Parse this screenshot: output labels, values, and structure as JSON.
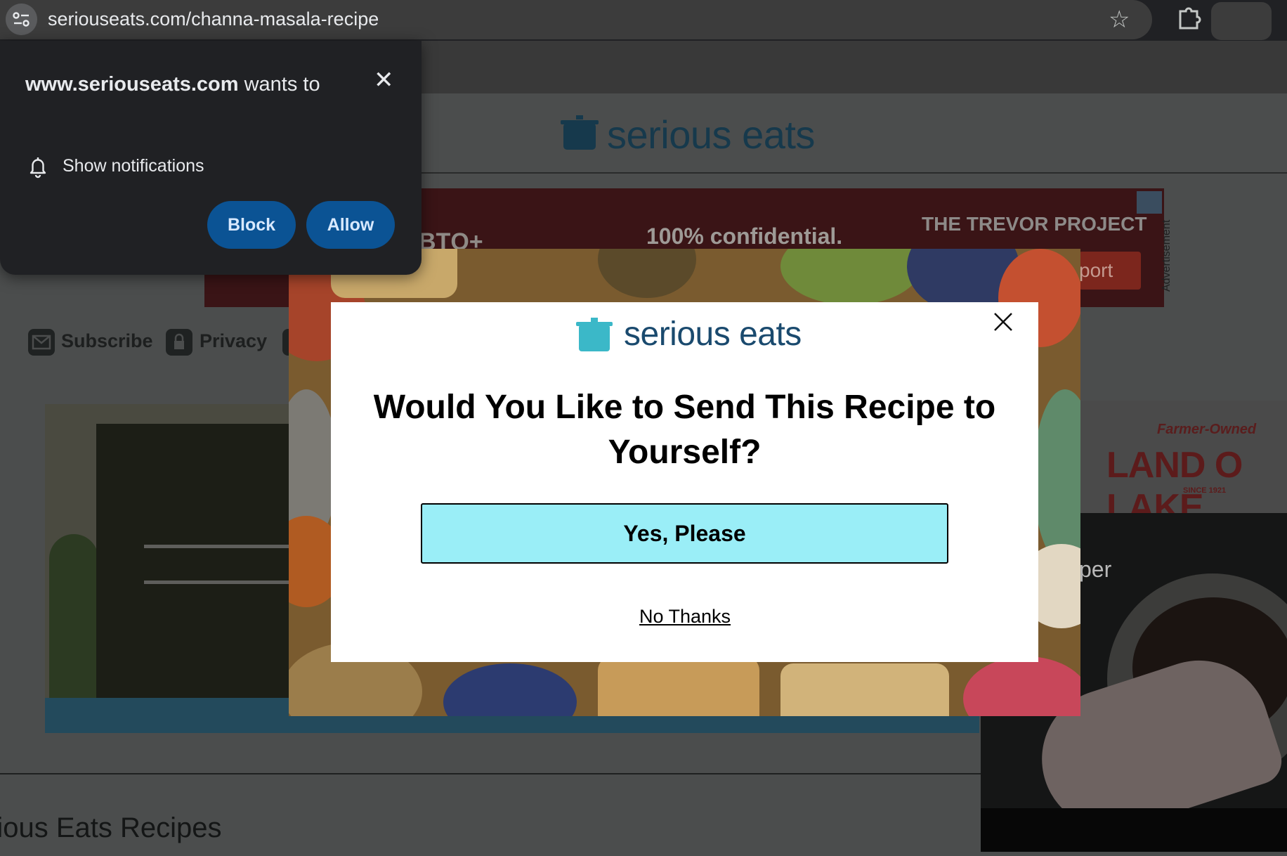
{
  "browser": {
    "url": "seriouseats.com/channa-masala-recipe"
  },
  "site": {
    "logo_text": "serious eats",
    "brand_color": "#16394c"
  },
  "ad_banner": {
    "tagline": "100% confidential.",
    "lgbt_text": "BTQ+",
    "org": "THE TREVOR PROJECT",
    "button": "port",
    "label": "Advertisement"
  },
  "toolbar": {
    "subscribe": "Subscribe",
    "privacy": "Privacy"
  },
  "side_ad": {
    "farmer_owned": "Farmer-Owned",
    "brand": "LAND O LAKE",
    "since": "SINCE 1921",
    "video_text": "per"
  },
  "section": {
    "title": "rious Eats Recipes"
  },
  "permission_prompt": {
    "site": "www.seriouseats.com",
    "wants_to": " wants to",
    "item": "Show notifications",
    "block": "Block",
    "allow": "Allow"
  },
  "modal": {
    "logo_text": "serious eats",
    "heading": "Would You Like to Send This Recipe to Yourself?",
    "yes_button": "Yes, Please",
    "no_link": "No Thanks",
    "button_color": "#9aeef7"
  }
}
